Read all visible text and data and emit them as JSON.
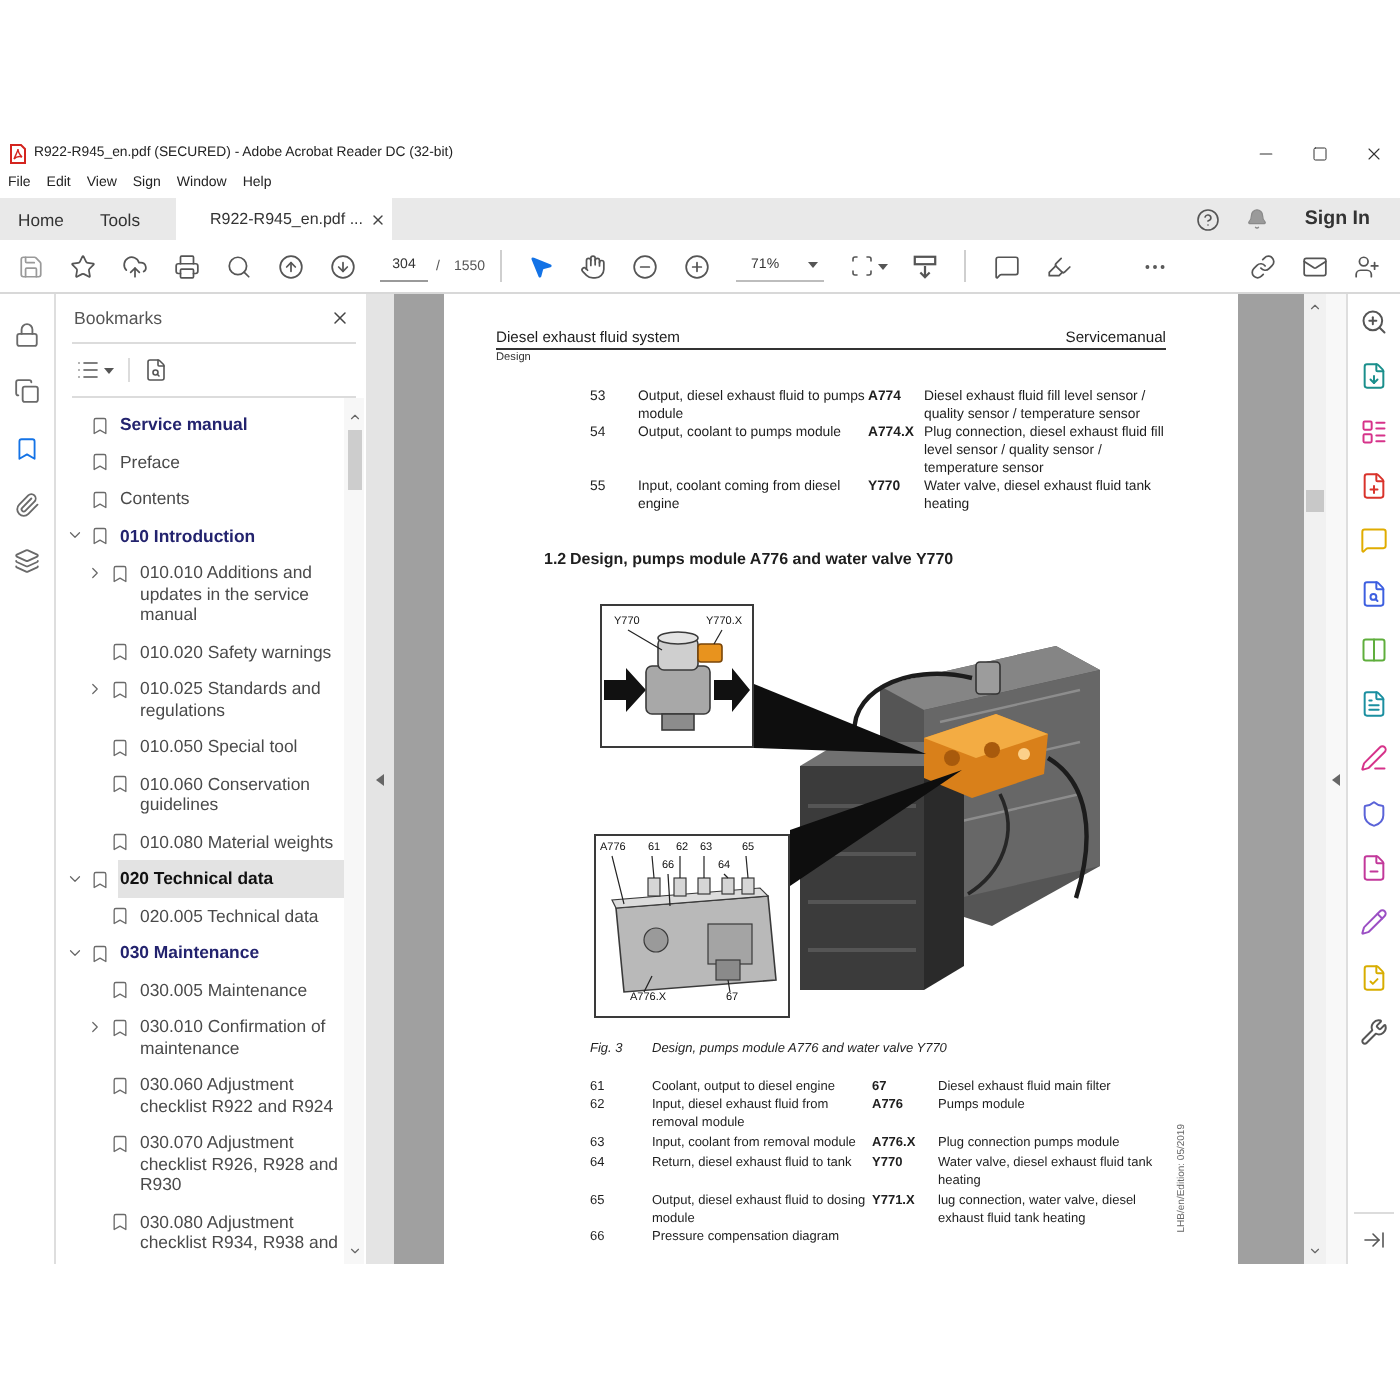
{
  "window": {
    "title": "R922-R945_en.pdf (SECURED) - Adobe Acrobat Reader DC (32-bit)"
  },
  "menu": [
    "File",
    "Edit",
    "View",
    "Sign",
    "Window",
    "Help"
  ],
  "tabs": [
    {
      "label": "Home",
      "kind": "nav",
      "selected": false
    },
    {
      "label": "Tools",
      "kind": "nav",
      "selected": false
    },
    {
      "label": "R922-R945_en.pdf ...",
      "kind": "document",
      "selected": true
    }
  ],
  "account": {
    "sign_in": "Sign In"
  },
  "toolbar": {
    "page": "304",
    "page_separator": "/",
    "page_count": "1550",
    "zoom": "71%",
    "tools": [
      {
        "kind": "select",
        "selected": true
      },
      {
        "kind": "hand",
        "selected": false
      }
    ]
  },
  "left_rail": [
    {
      "kind": "lock",
      "selected": false
    },
    {
      "kind": "pages",
      "selected": false
    },
    {
      "kind": "bookmarks",
      "selected": true
    },
    {
      "kind": "attachments",
      "selected": false
    },
    {
      "kind": "layers",
      "selected": false
    }
  ],
  "bookmarks": {
    "title": "Bookmarks",
    "items": [
      {
        "label": "Service manual",
        "kind": "chapter",
        "selected": false
      },
      {
        "label": "Preface",
        "kind": "entry",
        "selected": false
      },
      {
        "label": "Contents",
        "kind": "entry",
        "selected": false
      },
      {
        "label": "010 Introduction",
        "kind": "chapter",
        "expanded": true,
        "selected": false,
        "children": [
          {
            "label": "010.010 Additions and updates in the service manual",
            "kind": "entry",
            "expanded": false,
            "selected": false
          },
          {
            "label": "010.020 Safety warnings",
            "kind": "entry",
            "selected": false
          },
          {
            "label": "010.025 Standards and regulations",
            "kind": "entry",
            "expanded": false,
            "selected": false
          },
          {
            "label": "010.050 Special tool",
            "kind": "entry",
            "selected": false
          },
          {
            "label": "010.060 Conservation guidelines",
            "kind": "entry",
            "selected": false
          },
          {
            "label": "010.080 Material weights",
            "kind": "entry",
            "selected": false
          }
        ]
      },
      {
        "label": "020 Technical data",
        "kind": "chapter",
        "expanded": true,
        "selected": true,
        "children": [
          {
            "label": "020.005 Technical data",
            "kind": "entry",
            "selected": false
          }
        ]
      },
      {
        "label": "030 Maintenance",
        "kind": "chapter",
        "expanded": true,
        "selected": false,
        "children": [
          {
            "label": "030.005 Maintenance",
            "kind": "entry",
            "selected": false
          },
          {
            "label": "030.010 Confirmation of maintenance",
            "kind": "entry",
            "expanded": false,
            "selected": false
          },
          {
            "label": "030.060 Adjustment checklist R922 and R924",
            "kind": "entry",
            "selected": false
          },
          {
            "label": "030.070 Adjustment checklist R926, R928 and R930",
            "kind": "entry",
            "selected": false
          },
          {
            "label": "030.080 Adjustment checklist R934, R938 and",
            "kind": "entry",
            "selected": false
          }
        ]
      }
    ]
  },
  "document": {
    "header": {
      "title": "Diesel exhaust fluid system",
      "manual": "Servicemanual",
      "section": "Design"
    },
    "parts_table": [
      {
        "number": "53",
        "description": "Output, diesel exhaust fluid to pumps module",
        "code": "A774",
        "code_description": "Diesel exhaust fluid fill level sensor / quality sensor / temperature sensor"
      },
      {
        "number": "54",
        "description": "Output, coolant to pumps module",
        "code": "A774.X",
        "code_description": "Plug connection, diesel exhaust fluid fill level sensor / quality sensor / temperature sensor"
      },
      {
        "number": "55",
        "description": "Input, coolant coming from diesel engine",
        "code": "Y770",
        "code_description": "Water valve, diesel exhaust fluid tank heating"
      }
    ],
    "heading": {
      "number": "1.2",
      "title": "Design, pumps module A776 and water valve Y770"
    },
    "figure": {
      "valve_labels": [
        "Y770",
        "Y770.X"
      ],
      "pump_labels": [
        "A776",
        "61",
        "62",
        "63",
        "65",
        "66",
        "64",
        "A776.X",
        "67"
      ]
    },
    "caption": {
      "number": "Fig. 3",
      "text": "Design, pumps module A776 and water valve Y770"
    },
    "legend": [
      {
        "number": "61",
        "description": "Coolant, output to diesel engine",
        "code": "67",
        "code_description": "Diesel exhaust fluid main filter"
      },
      {
        "number": "62",
        "description": "Input, diesel exhaust fluid from removal module",
        "code": "A776",
        "code_description": "Pumps module"
      },
      {
        "number": "63",
        "description": "Input, coolant from removal module",
        "code": "A776.X",
        "code_description": "Plug connection pumps module"
      },
      {
        "number": "64",
        "description": "Return, diesel exhaust fluid to tank",
        "code": "Y770",
        "code_description": "Water valve, diesel exhaust fluid tank heating"
      },
      {
        "number": "65",
        "description": "Output, diesel exhaust fluid to dosing module",
        "code": "Y771.X",
        "code_description": "lug connection, water valve, diesel exhaust fluid tank heating"
      },
      {
        "number": "66",
        "description": "Pressure compensation diagram"
      }
    ],
    "edition": "LHB/en/Edition: 05/2019"
  }
}
